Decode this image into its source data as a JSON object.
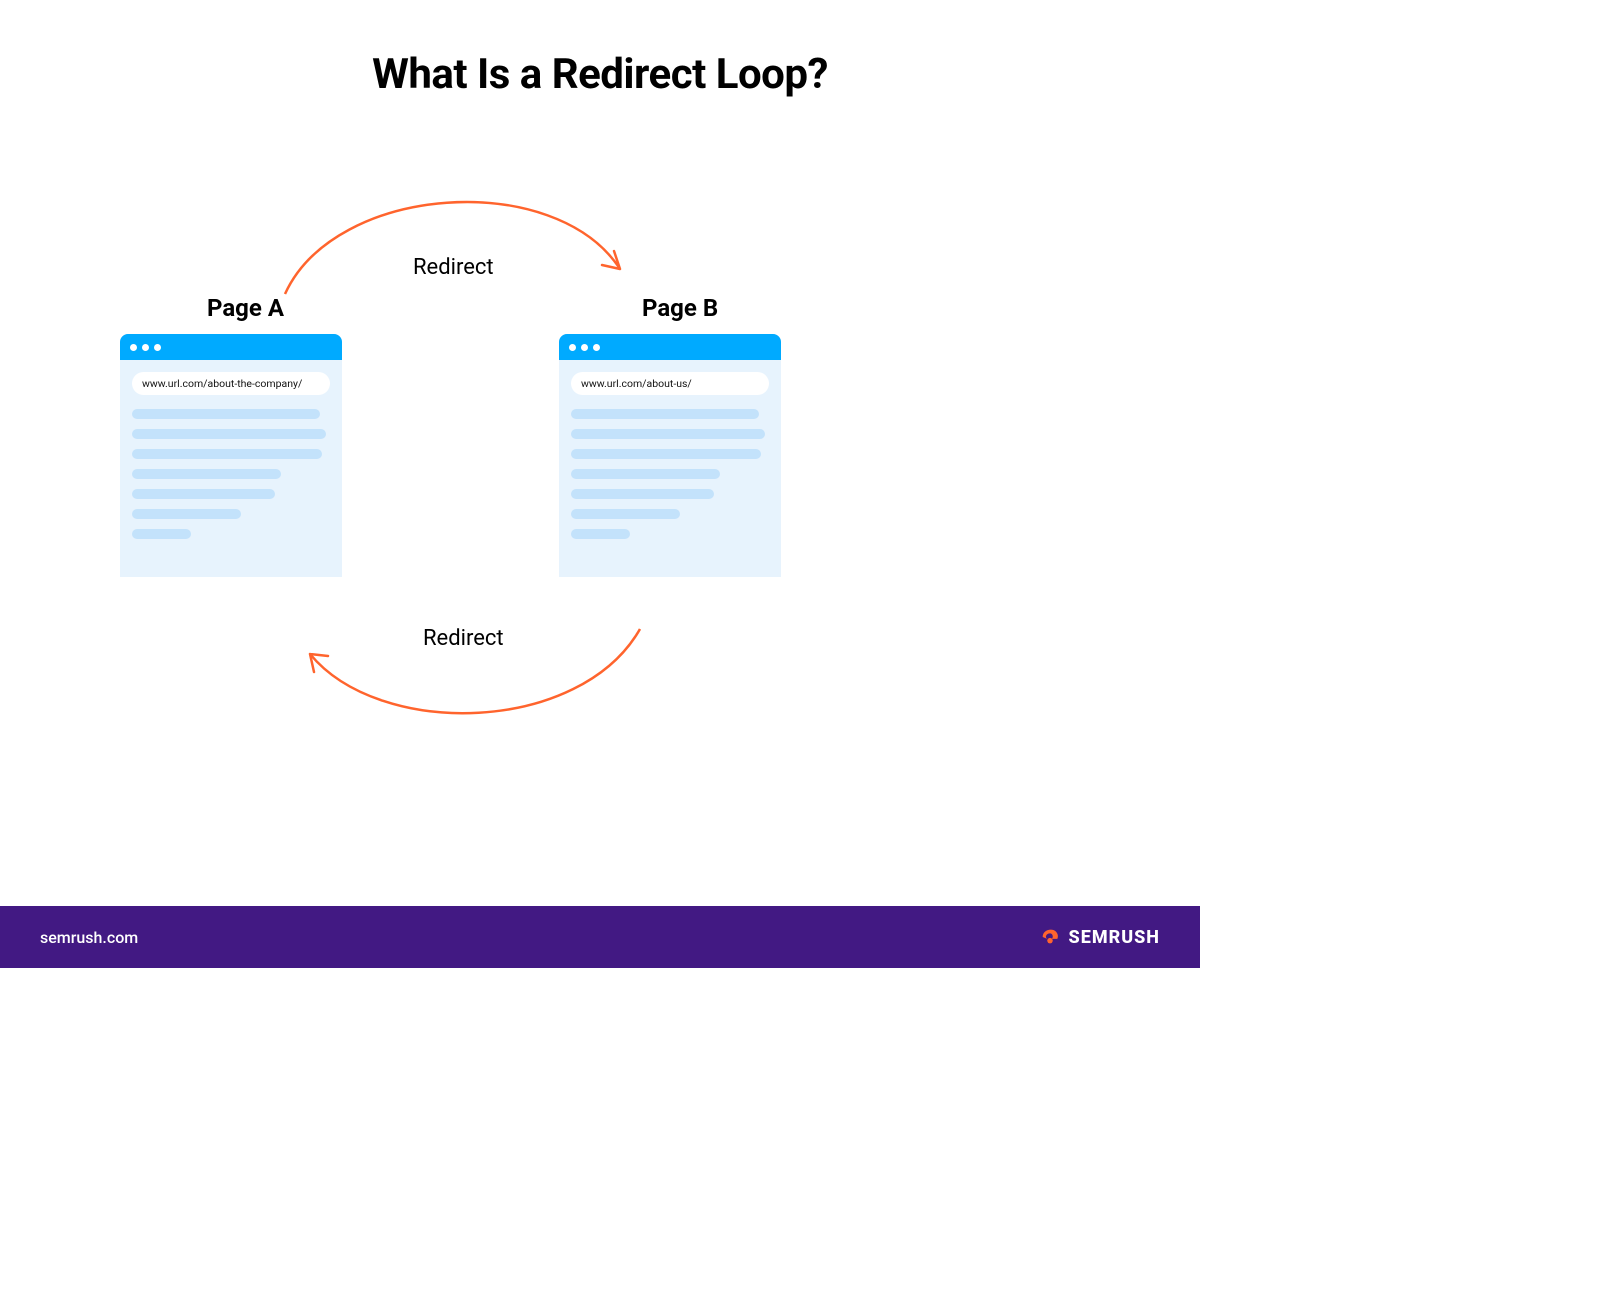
{
  "title": "What Is a Redirect Loop?",
  "pages": {
    "a": {
      "label": "Page A",
      "url": "www.url.com/about-the-company/"
    },
    "b": {
      "label": "Page B",
      "url": "www.url.com/about-us/"
    }
  },
  "arrows": {
    "top_label": "Redirect",
    "bottom_label": "Redirect"
  },
  "footer": {
    "domain": "semrush.com",
    "brand": "SEMRUSH"
  },
  "colors": {
    "accent": "#ff642d",
    "browser_chrome": "#00aaff",
    "footer_bg": "#421983"
  }
}
